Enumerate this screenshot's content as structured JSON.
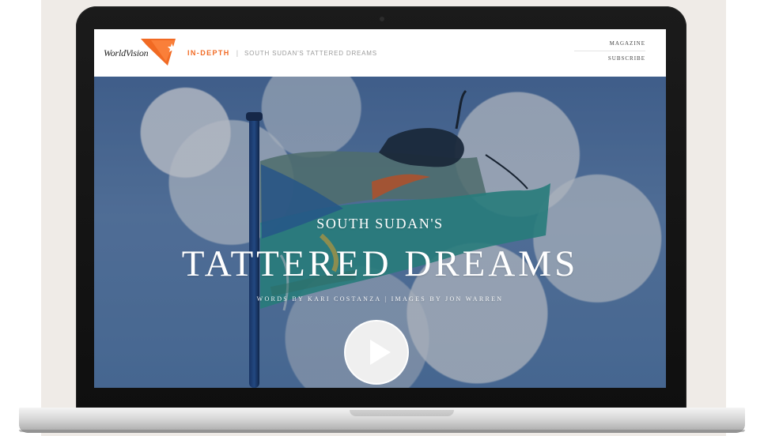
{
  "header": {
    "brand": "WorldVision",
    "section": "IN-DEPTH",
    "story": "SOUTH SUDAN'S TATTERED DREAMS",
    "nav": {
      "magazine": "MAGAZINE",
      "subscribe": "SUBSCRIBE"
    }
  },
  "hero": {
    "kicker": "SOUTH SUDAN'S",
    "title": "TATTERED DREAMS",
    "credits": "WORDS BY KARI COSTANZA  |  IMAGES BY JON WARREN"
  },
  "icons": {
    "logo": "worldvision-logo-icon",
    "play": "play-icon"
  },
  "colors": {
    "accent": "#f16a23",
    "overlay": "#0a1428",
    "laptop_base": "#d8d8d8"
  }
}
